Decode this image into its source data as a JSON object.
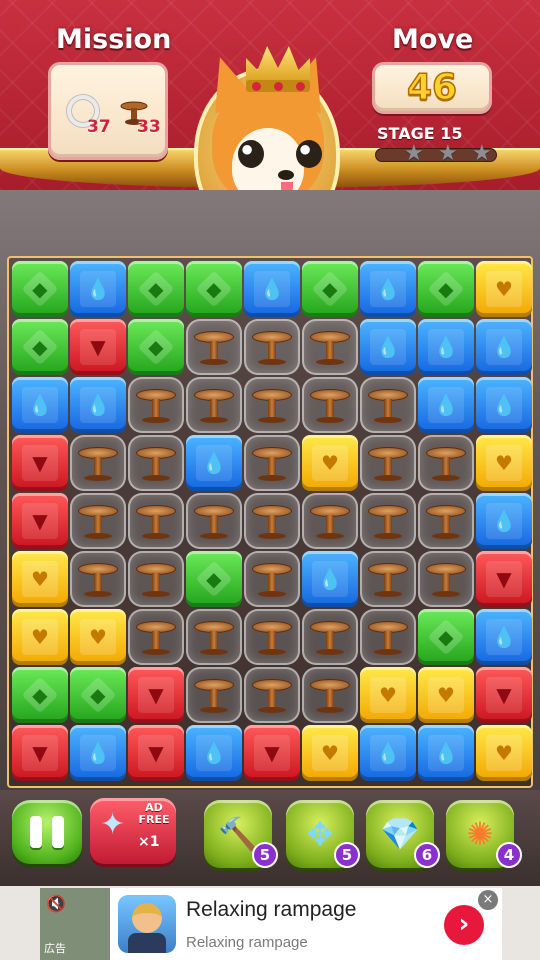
{
  "header": {
    "mission_title": "Mission",
    "move_title": "Move",
    "moves_left": "46",
    "stage_label": "STAGE 15",
    "stars_earned": 0,
    "stars_total": 3,
    "mission": {
      "ring_count": "37",
      "table_count": "33",
      "ring_icon": "ring-icon",
      "table_icon": "table-icon"
    }
  },
  "board": {
    "cols": 9,
    "rows": 9,
    "grid": [
      [
        "green",
        "blue",
        "green",
        "green",
        "blue",
        "green",
        "blue",
        "green",
        "yellow"
      ],
      [
        "green",
        "red",
        "green",
        "table",
        "table",
        "table",
        "blue",
        "blue",
        "blue"
      ],
      [
        "blue",
        "blue",
        "table",
        "table",
        "table",
        "table",
        "table",
        "blue",
        "blue"
      ],
      [
        "red",
        "table",
        "table",
        "blue",
        "table",
        "yellow",
        "table",
        "table",
        "yellow"
      ],
      [
        "red",
        "table",
        "table",
        "table",
        "table",
        "table",
        "table",
        "table",
        "blue"
      ],
      [
        "yellow",
        "table",
        "table",
        "green",
        "table",
        "blue",
        "table",
        "table",
        "red"
      ],
      [
        "yellow",
        "yellow",
        "table",
        "table",
        "table",
        "table",
        "table",
        "green",
        "blue"
      ],
      [
        "green",
        "green",
        "red",
        "table",
        "table",
        "table",
        "yellow",
        "yellow",
        "red"
      ],
      [
        "red",
        "blue",
        "red",
        "blue",
        "red",
        "yellow",
        "blue",
        "blue",
        "yellow"
      ]
    ],
    "glyphs": {
      "green": "◆",
      "blue": "💧",
      "red": "▼",
      "yellow": "♥"
    }
  },
  "boosters": {
    "pause_icon": "pause-icon",
    "adfree": {
      "label_line1": "AD",
      "label_line2": "FREE",
      "count": "×1"
    },
    "items": [
      {
        "name": "hammer",
        "icon": "🔨",
        "count": "5"
      },
      {
        "name": "cross-blast",
        "icon": "✥",
        "count": "5"
      },
      {
        "name": "bomb",
        "icon": "💎",
        "count": "6"
      },
      {
        "name": "color-bomb",
        "icon": "✺",
        "count": "4"
      }
    ]
  },
  "ad": {
    "title": "Relaxing rampage",
    "subtitle": "Relaxing rampage",
    "tag": "広告",
    "go_symbol": "›",
    "close_symbol": "×",
    "mute_symbol": "🔇"
  }
}
